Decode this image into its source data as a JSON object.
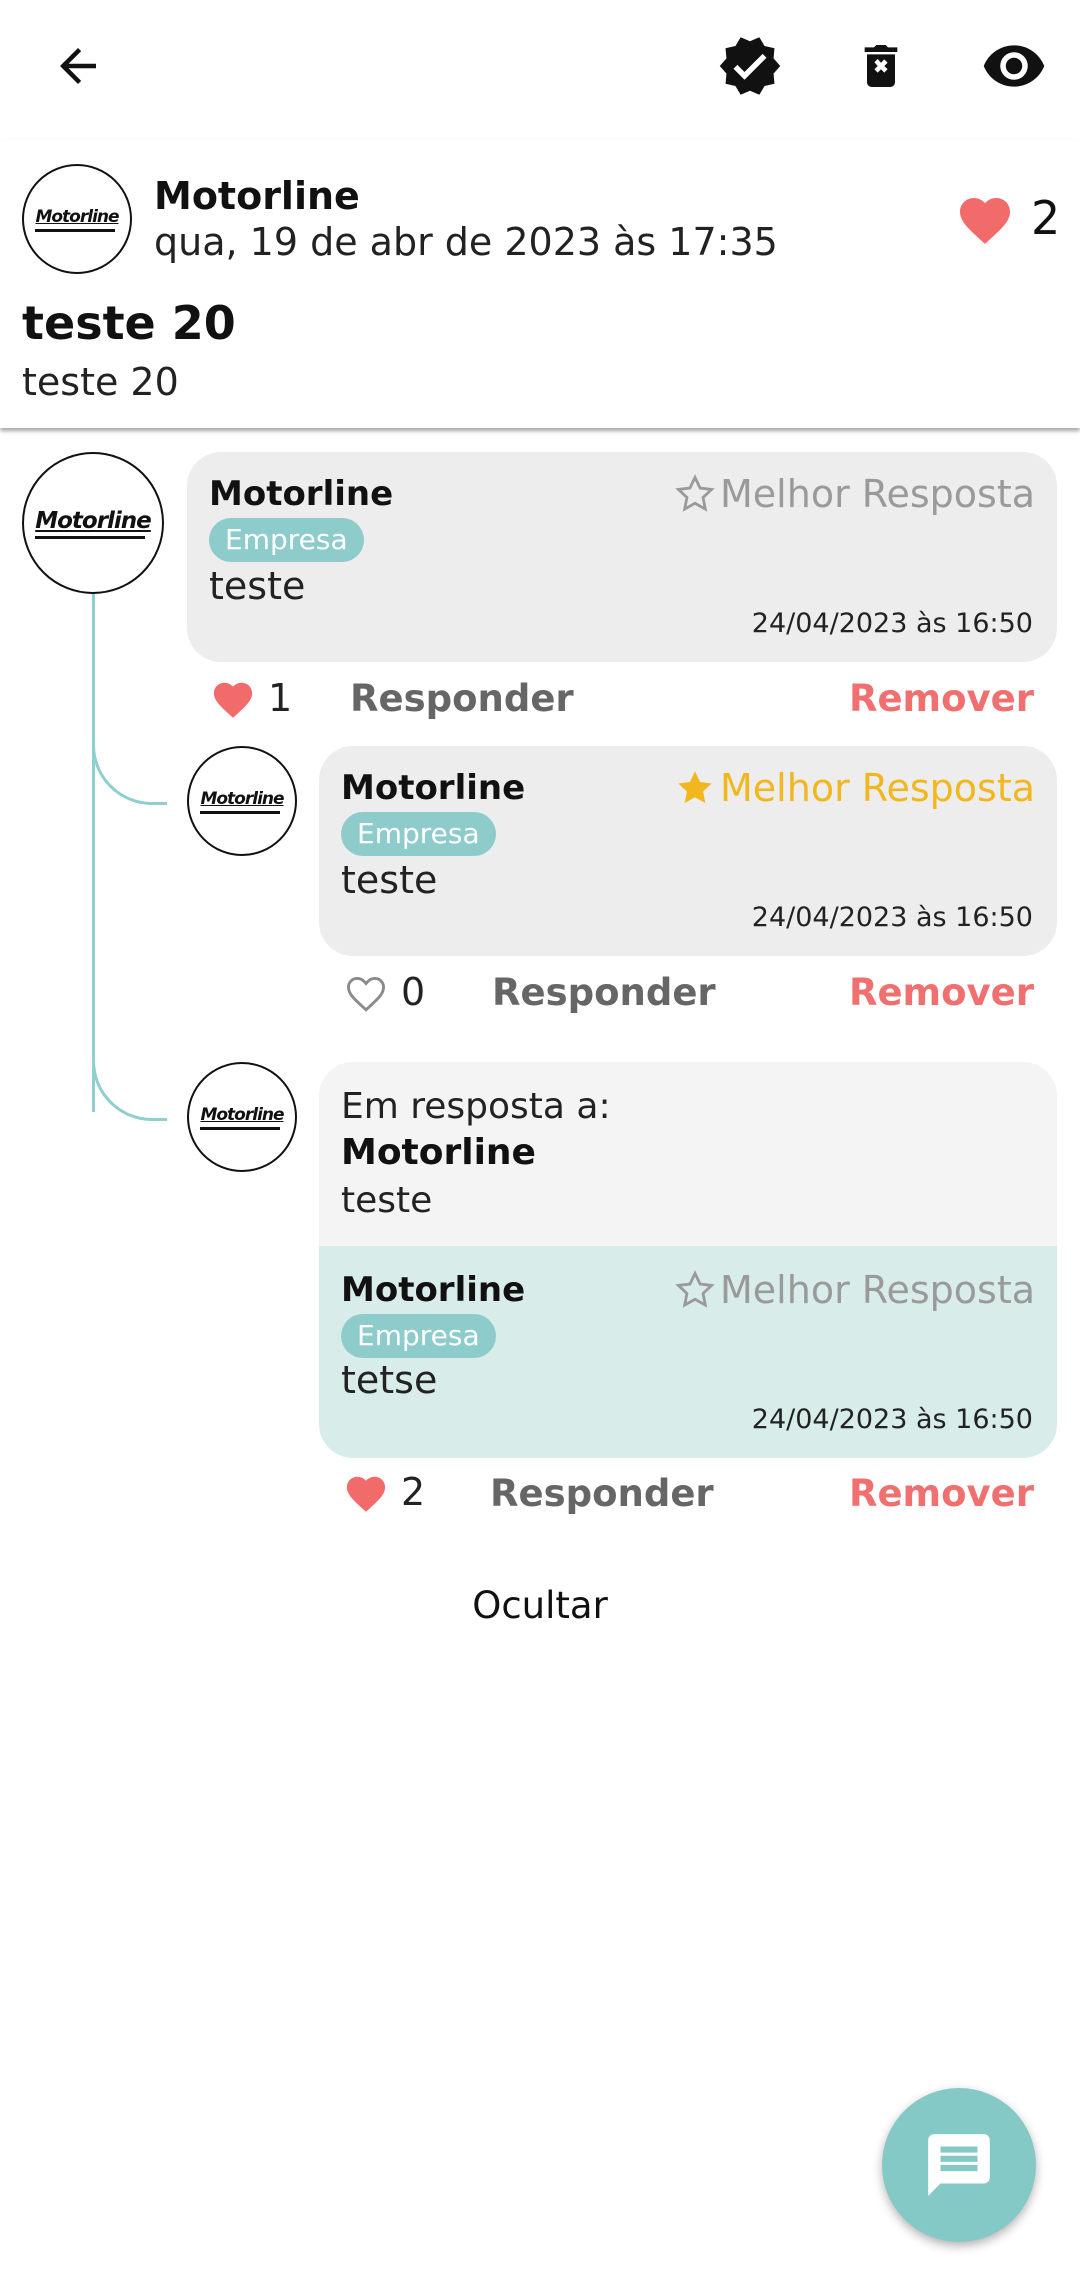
{
  "toolbar": {
    "back_icon": "arrow-back-icon",
    "verified_icon": "verified-badge-icon",
    "delete_icon": "delete-icon",
    "view_icon": "eye-icon"
  },
  "post": {
    "author": "Motorline",
    "logo_text": "Motorline",
    "date": "qua, 19 de abr de 2023 às 17:35",
    "likes": "2",
    "title": "teste 20",
    "body": "teste 20"
  },
  "comments": [
    {
      "author": "Motorline",
      "badge": "Empresa",
      "best_label": "Melhor Resposta",
      "best_active": false,
      "text": "teste",
      "date": "24/04/2023 às 16:50",
      "likes": "1",
      "reply": "Responder",
      "remove": "Remover"
    },
    {
      "author": "Motorline",
      "badge": "Empresa",
      "best_label": "Melhor Resposta",
      "best_active": true,
      "text": "teste",
      "date": "24/04/2023 às 16:50",
      "likes": "0",
      "reply": "Responder",
      "remove": "Remover"
    },
    {
      "quote_label": "Em resposta a:",
      "quote_author": "Motorline",
      "quote_text": "teste",
      "author": "Motorline",
      "badge": "Empresa",
      "best_label": "Melhor Resposta",
      "best_active": false,
      "text": "tetse",
      "date": "24/04/2023 às 16:50",
      "likes": "2",
      "reply": "Responder",
      "remove": "Remover"
    }
  ],
  "hide_label": "Ocultar",
  "colors": {
    "accent": "#84c9c6",
    "heart": "#f26b6b",
    "remove": "#f07070",
    "star_active": "#f2b61f"
  }
}
